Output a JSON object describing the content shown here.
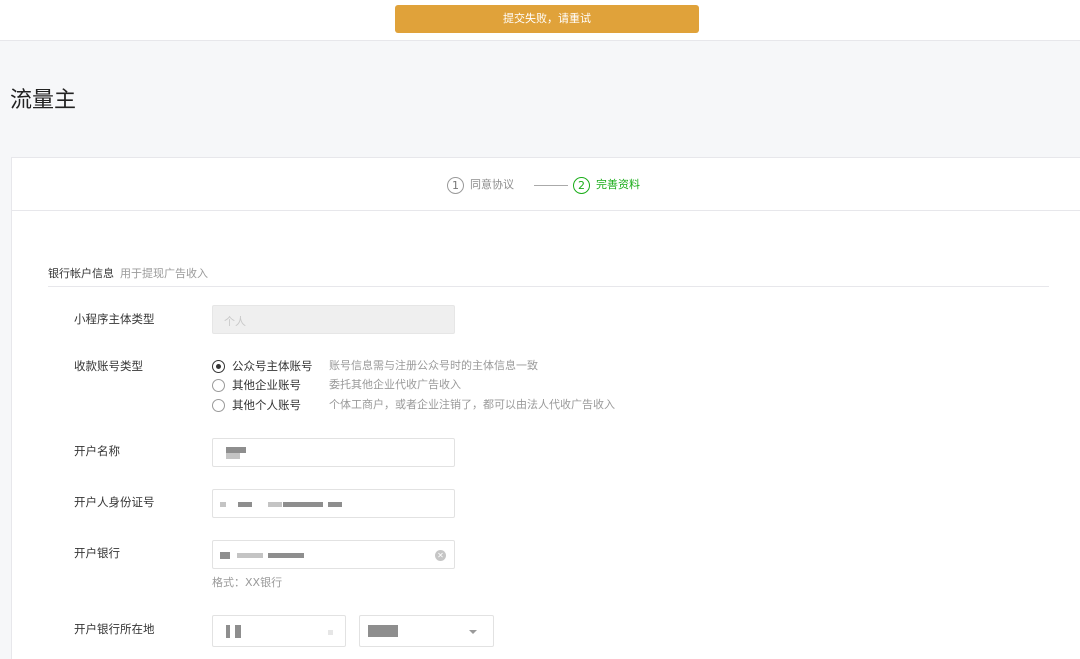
{
  "toast": {
    "message": "提交失败，请重试",
    "color": "#e0a23a"
  },
  "page_title": "流量主",
  "steps": [
    {
      "number": "1",
      "label": "同意协议",
      "state": "done"
    },
    {
      "number": "2",
      "label": "完善资料",
      "state": "active"
    }
  ],
  "accent_color": "#1aad19",
  "section": {
    "title": "银行帐户信息",
    "subtitle": "用于提现广告收入"
  },
  "form": {
    "subject_type": {
      "label": "小程序主体类型",
      "placeholder": "个人",
      "disabled": true
    },
    "account_type": {
      "label": "收款账号类型",
      "options": [
        {
          "label": "公众号主体账号",
          "hint": "账号信息需与注册公众号时的主体信息一致",
          "selected": true
        },
        {
          "label": "其他企业账号",
          "hint": "委托其他企业代收广告收入",
          "selected": false
        },
        {
          "label": "其他个人账号",
          "hint": "个体工商户，或者企业注销了，都可以由法人代收广告收入",
          "selected": false
        }
      ]
    },
    "account_name": {
      "label": "开户名称",
      "value_masked": true
    },
    "id_number": {
      "label": "开户人身份证号",
      "value_masked": true
    },
    "bank": {
      "label": "开户银行",
      "value_masked": true,
      "helper": "格式：XX银行",
      "clear_icon": "clear-circle-icon"
    },
    "bank_location": {
      "label": "开户银行所在地",
      "province_masked": true,
      "city_masked": true,
      "dropdown_icon": "chevron-down-icon"
    }
  }
}
